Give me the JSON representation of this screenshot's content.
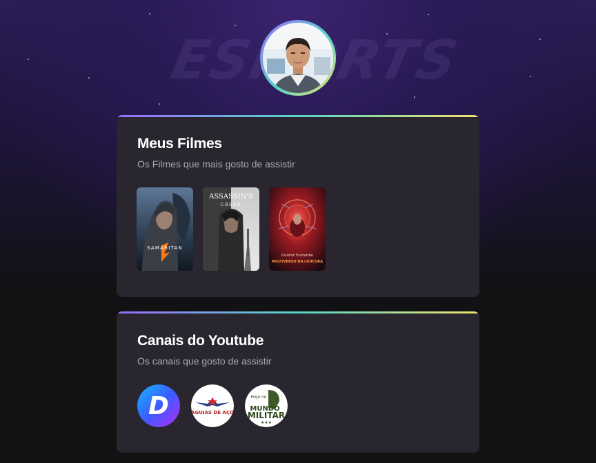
{
  "background": {
    "logo_text": "ESPORTS"
  },
  "profile": {
    "avatar_alt": "Foto de perfil"
  },
  "movies_section": {
    "title": "Meus Filmes",
    "subtitle": "Os Filmes que mais gosto de assistir",
    "items": [
      {
        "poster_text": "SAMARITAN"
      },
      {
        "poster_text": "ASSASSIN'S",
        "poster_subtext": "CREED"
      },
      {
        "poster_text": "Doutor Estranho",
        "poster_subtext": "MULTIVERSO DA LOUCURA"
      }
    ]
  },
  "youtube_section": {
    "title": "Canais do Youtube",
    "subtitle": "Os canais que gosto de assistir",
    "items": [
      {
        "logo_text": "D"
      },
      {
        "logo_text": "ÁGUIAS DE AÇO"
      },
      {
        "logo_text_top": "Hoje no",
        "logo_text_mid": "MUNDO",
        "logo_text_bottom": "MILITAR"
      }
    ]
  },
  "colors": {
    "accent_gradient": [
      "#9b6bff",
      "#55d6c8",
      "#f2e26b"
    ],
    "card_bg": "#29262f",
    "page_bg": "#121214",
    "title_color": "#ffffff",
    "subtitle_color": "#a8a8b3"
  }
}
